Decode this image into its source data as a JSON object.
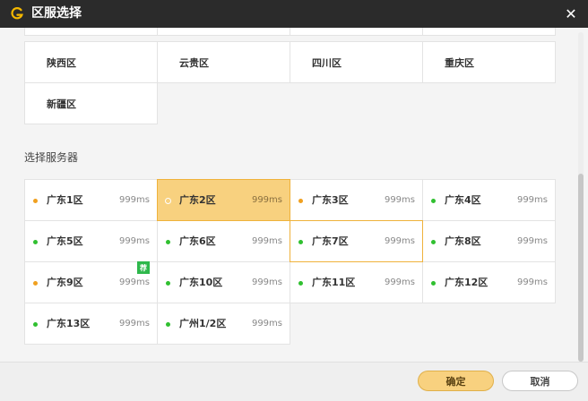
{
  "window": {
    "title": "区服选择",
    "close_glyph": "✕"
  },
  "colors": {
    "accent": "#f8d17f",
    "accent_border": "#efb23b",
    "online": "#30c030",
    "busy": "#f0a020",
    "new_badge": "#2eb84c",
    "titlebar": "#2b2b2b"
  },
  "icons": {
    "logo": "g-logo-icon",
    "close": "close-icon",
    "status": "status-dot-icon"
  },
  "regions": [
    {
      "label": "陕西区"
    },
    {
      "label": "云贵区"
    },
    {
      "label": "四川区"
    },
    {
      "label": "重庆区"
    },
    {
      "label": "新疆区"
    }
  ],
  "server_section_label": "选择服务器",
  "servers": [
    {
      "name": "广东1区",
      "ping": "999ms",
      "status": "busy"
    },
    {
      "name": "广东2区",
      "ping": "999ms",
      "status": "selected"
    },
    {
      "name": "广东3区",
      "ping": "999ms",
      "status": "busy"
    },
    {
      "name": "广东4区",
      "ping": "999ms",
      "status": "online"
    },
    {
      "name": "广东5区",
      "ping": "999ms",
      "status": "online"
    },
    {
      "name": "广东6区",
      "ping": "999ms",
      "status": "online"
    },
    {
      "name": "广东7区",
      "ping": "999ms",
      "status": "online"
    },
    {
      "name": "广东8区",
      "ping": "999ms",
      "status": "online"
    },
    {
      "name": "广东9区",
      "ping": "999ms",
      "status": "busy",
      "badge": "荐"
    },
    {
      "name": "广东10区",
      "ping": "999ms",
      "status": "online"
    },
    {
      "name": "广东11区",
      "ping": "999ms",
      "status": "online"
    },
    {
      "name": "广东12区",
      "ping": "999ms",
      "status": "online"
    },
    {
      "name": "广东13区",
      "ping": "999ms",
      "status": "online"
    },
    {
      "name": "广州1/2区",
      "ping": "999ms",
      "status": "online"
    }
  ],
  "footer": {
    "confirm_label": "确定",
    "cancel_label": "取消"
  }
}
